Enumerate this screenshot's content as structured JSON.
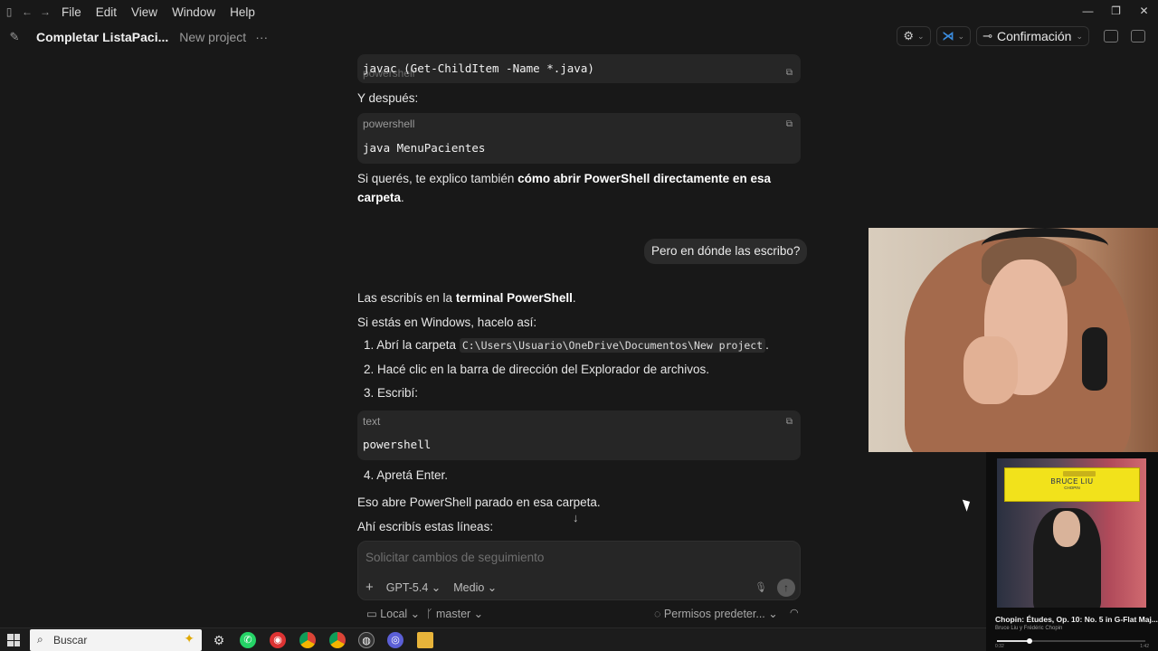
{
  "menubar": {
    "items": [
      "File",
      "Edit",
      "View",
      "Window",
      "Help"
    ],
    "window_controls": [
      "—",
      "❐",
      "✕"
    ]
  },
  "header": {
    "title": "Completar ListaPaci...",
    "project": "New project",
    "dots": "···",
    "mode_label": "Confirmación"
  },
  "messages": {
    "code1": "javac (Get-ChildItem -Name *.java)",
    "code1_lang_shadow": "powershell",
    "then": "Y después:",
    "code2_lang": "powershell",
    "code2": "java MenuPacientes",
    "offer_pre": "Si querés, te explico también ",
    "offer_bold": "cómo abrir PowerShell directamente en esa carpeta",
    "offer_post": ".",
    "user_question": "Pero en dónde las escribo?",
    "answer_pre": "Las escribís en la ",
    "answer_bold": "terminal PowerShell",
    "answer_post": ".",
    "windows_intro": "Si estás en Windows, hacelo así:",
    "step1_pre": "1. Abrí la carpeta ",
    "step1_path": "C:\\Users\\Usuario\\OneDrive\\Documentos\\New project",
    "step1_post": ".",
    "step2": "2. Hacé clic en la barra de dirección del Explorador de archivos.",
    "step3": "3. Escribí:",
    "code3_lang": "text",
    "code3": "powershell",
    "step4": "4. Apretá Enter.",
    "result": "Eso abre PowerShell parado en esa carpeta.",
    "lines_intro": "Ahí escribís estas líneas:"
  },
  "composer": {
    "placeholder": "Solicitar cambios de seguimiento",
    "plus": "+",
    "model": "GPT-5.4 ⌄",
    "effort": "Medio ⌄"
  },
  "statusbar": {
    "local": "Local ⌄",
    "branch": "master ⌄",
    "permissions": "Permisos predeter... ⌄"
  },
  "media": {
    "artist_cover": "BRUCE LIU",
    "composer_cover": "CHOPIN",
    "track": "Chopin: Études, Op. 10: No. 5 in G-Flat Maj...",
    "artists": "Bruce Liu y Frédéric Chopin",
    "progress": 0.22,
    "elapsed": "0:32",
    "total": "1:42"
  },
  "taskbar": {
    "search_text": "Buscar",
    "apps": [
      "gear-icon",
      "whatsapp-icon",
      "chrome-red-icon",
      "chrome-icon",
      "chrome-icon-2",
      "github-icon",
      "codex-icon",
      "folder-icon"
    ]
  },
  "colors": {
    "background": "#181818",
    "code_block": "#262626",
    "bubble": "#2b2b2b",
    "vscode_blue": "#3b8de0",
    "cover_yellow": "#f2e21b"
  }
}
